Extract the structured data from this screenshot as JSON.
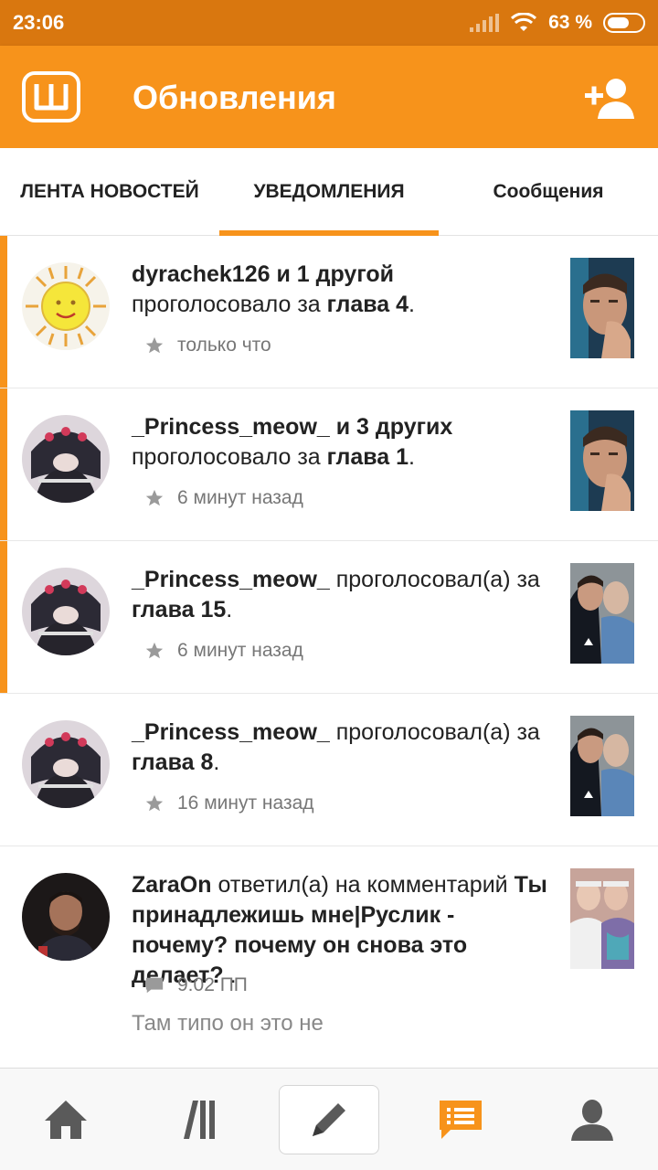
{
  "status_bar": {
    "time": "23:06",
    "battery": "63 %",
    "battery_level": 0.63
  },
  "app_bar": {
    "title": "Обновления",
    "logo_icon": "wattpad-logo-icon",
    "action_icon": "add-user-icon"
  },
  "tabs": [
    {
      "label": "ЛЕНТА НОВОСТЕЙ",
      "active": false
    },
    {
      "label": "УВЕДОМЛЕНИЯ",
      "active": true
    },
    {
      "label": "Сообщения",
      "active": false
    }
  ],
  "notifications": [
    {
      "user": "dyrachek126 и 1 другой",
      "action": " проголосовало за ",
      "target": "глава 4",
      "suffix": ".",
      "time": "только что",
      "meta_icon": "star-icon",
      "unread": true
    },
    {
      "user": "_Princess_meow_ и 3 других",
      "action": " проголосовало за ",
      "target": "глава 1",
      "suffix": ".",
      "time": "6 минут назад",
      "meta_icon": "star-icon",
      "unread": true
    },
    {
      "user": "_Princess_meow_",
      "action": " проголосовал(а) за ",
      "target": "глава 15",
      "suffix": ".",
      "time": "6 минут назад",
      "meta_icon": "star-icon",
      "unread": true
    },
    {
      "user": "_Princess_meow_",
      "action": " проголосовал(а) за ",
      "target": "глава 8",
      "suffix": ".",
      "time": "16 минут назад",
      "meta_icon": "star-icon",
      "unread": false
    },
    {
      "user": "ZaraOn",
      "action": " ответил(а) на комментарий ",
      "target": "Ты принадлежишь мне|Руслик - почему? почему он снова это делает?",
      "suffix": " .",
      "time": "9:02 ПП",
      "meta_icon": "comment-icon",
      "preview": "Там типо он это не",
      "unread": false
    }
  ],
  "bottom_nav": [
    {
      "icon": "home-icon"
    },
    {
      "icon": "library-icon"
    },
    {
      "icon": "pencil-icon"
    },
    {
      "icon": "notifications-icon",
      "active": true
    },
    {
      "icon": "profile-icon"
    }
  ],
  "colors": {
    "accent": "#f7931b",
    "status_bar": "#d9770f",
    "meta_text": "#777777"
  }
}
